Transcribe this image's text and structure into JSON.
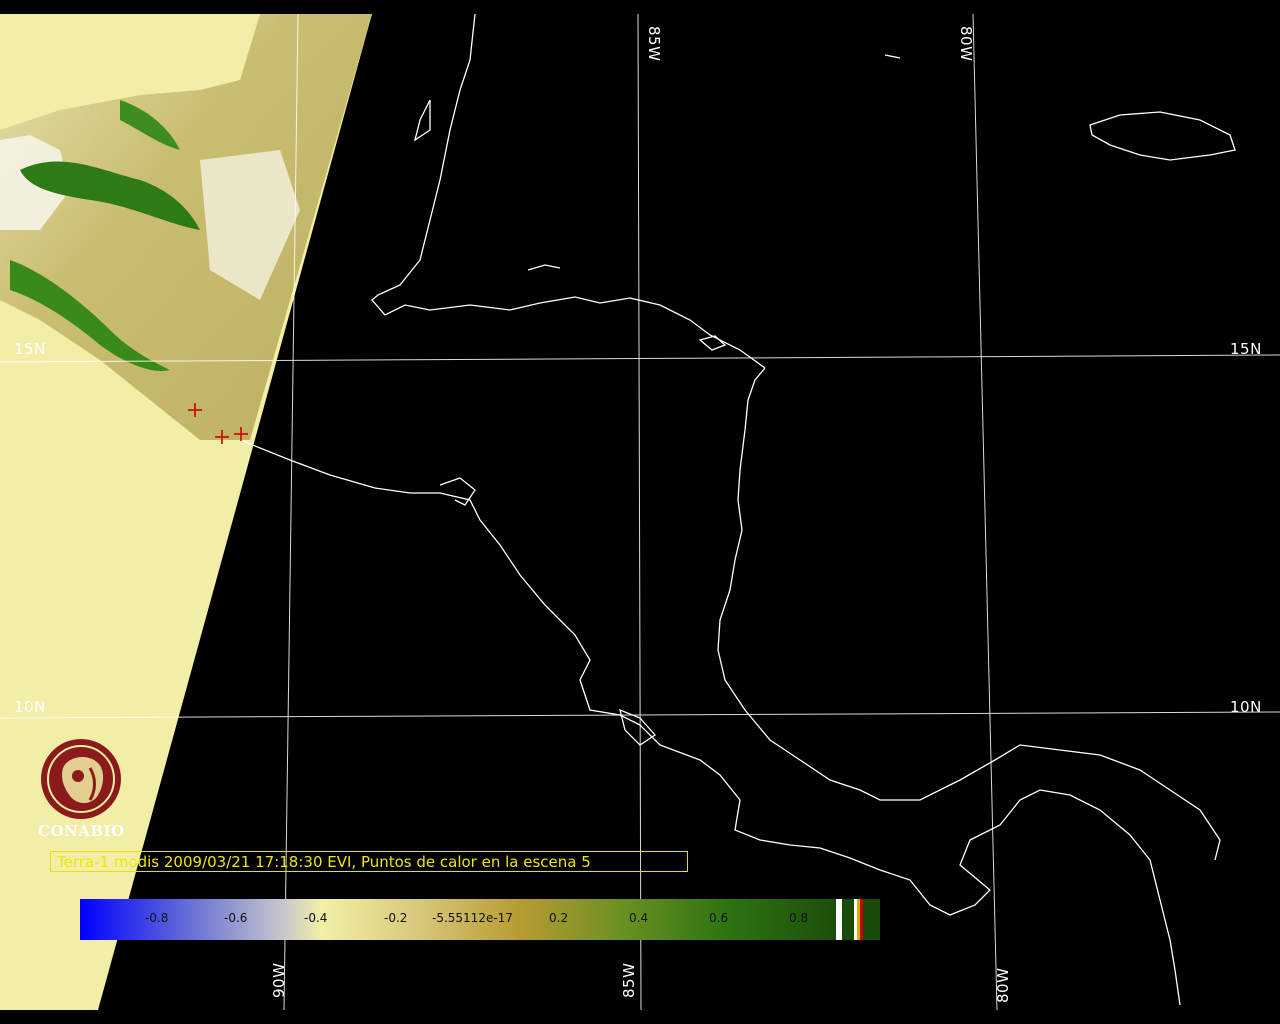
{
  "map": {
    "caption": "Terra-1 modis 2009/03/21 17:18:30 EVI, Puntos de calor en la escena 5",
    "grid_labels": {
      "lat_15": "15N",
      "lat_10": "10N",
      "lon_85_top": "85W",
      "lon_80_top": "80W",
      "lon_90_bottom": "90W",
      "lon_85_bottom": "85W",
      "lon_80_bottom": "80W"
    },
    "colorbar": {
      "ticks": [
        "-0.8",
        "-0.6",
        "-0.4",
        "-0.2",
        "-5.55112e-17",
        "0.2",
        "0.4",
        "0.6",
        "0.8"
      ],
      "colors": [
        "#0000ff",
        "#8f96d6",
        "#f2f0a6",
        "#c8a648",
        "#b39f28",
        "#4a8c14",
        "#2f6b10",
        "#1e4d0a"
      ]
    },
    "logo_text": "CONABIO",
    "hotspot_count": 3,
    "colors": {
      "background": "#000000",
      "land_outside_swath": "#f2eea8",
      "grid": "#ffffff",
      "caption": "#f0e600",
      "hotspot": "#cc0000",
      "logo": "#8b1a1a"
    }
  }
}
